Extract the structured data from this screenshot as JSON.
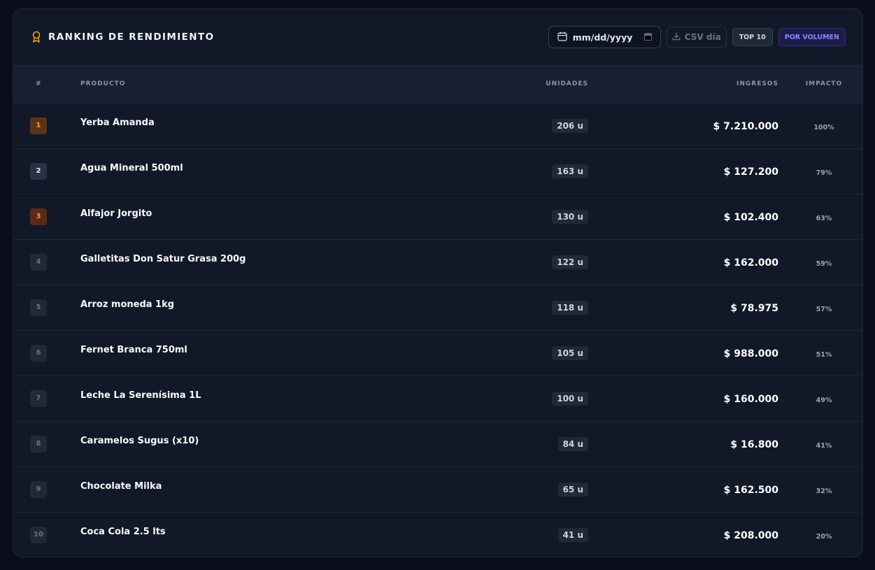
{
  "header": {
    "title": "RANKING DE RENDIMIENTO",
    "date_placeholder": "mm/dd/yyyy",
    "csv_label": "CSV día",
    "top_label": "TOP 10",
    "order_label": "POR VOLUMEN"
  },
  "columns": {
    "rank": "#",
    "product": "PRODUCTO",
    "units": "UNIDADES",
    "revenue": "INGRESOS",
    "impact": "IMPACTO"
  },
  "colors": {
    "accent_gold": "#f59e0b",
    "accent_indigo": "#818cf8",
    "panel_bg": "#111827",
    "page_bg": "#0a0e1c"
  },
  "rows": [
    {
      "rank": "1",
      "product": "Yerba Amanda",
      "units": "206 u",
      "revenue": "$ 7.210.000",
      "impact": "100%",
      "medal": "gold"
    },
    {
      "rank": "2",
      "product": "Agua Mineral 500ml",
      "units": "163 u",
      "revenue": "$ 127.200",
      "impact": "79%",
      "medal": "silver"
    },
    {
      "rank": "3",
      "product": "Alfajor Jorgito",
      "units": "130 u",
      "revenue": "$ 102.400",
      "impact": "63%",
      "medal": "bronze"
    },
    {
      "rank": "4",
      "product": "Galletitas Don Satur Grasa 200g",
      "units": "122 u",
      "revenue": "$ 162.000",
      "impact": "59%",
      "medal": ""
    },
    {
      "rank": "5",
      "product": "Arroz moneda 1kg",
      "units": "118 u",
      "revenue": "$ 78.975",
      "impact": "57%",
      "medal": ""
    },
    {
      "rank": "6",
      "product": "Fernet Branca 750ml",
      "units": "105 u",
      "revenue": "$ 988.000",
      "impact": "51%",
      "medal": ""
    },
    {
      "rank": "7",
      "product": "Leche La Serenísima 1L",
      "units": "100 u",
      "revenue": "$ 160.000",
      "impact": "49%",
      "medal": ""
    },
    {
      "rank": "8",
      "product": "Caramelos Sugus (x10)",
      "units": "84 u",
      "revenue": "$ 16.800",
      "impact": "41%",
      "medal": ""
    },
    {
      "rank": "9",
      "product": "Chocolate Milka",
      "units": "65 u",
      "revenue": "$ 162.500",
      "impact": "32%",
      "medal": ""
    },
    {
      "rank": "10",
      "product": "Coca Cola 2.5 lts",
      "units": "41 u",
      "revenue": "$ 208.000",
      "impact": "20%",
      "medal": ""
    }
  ]
}
